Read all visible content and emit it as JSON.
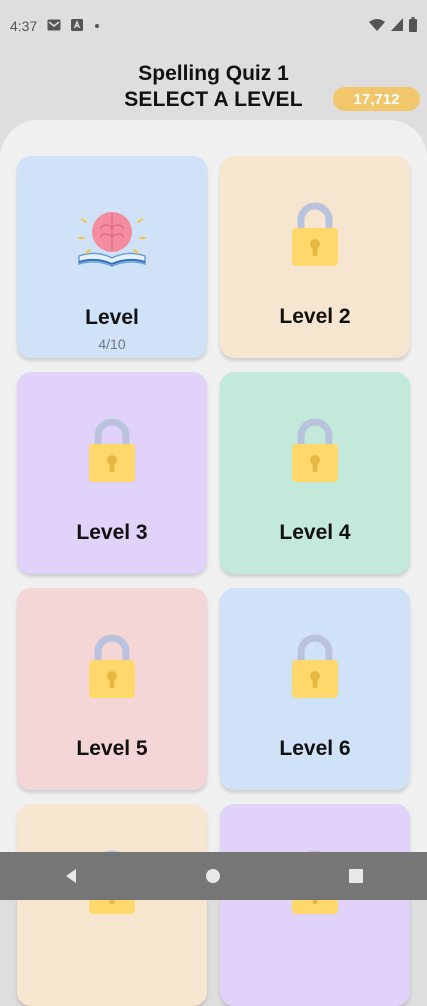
{
  "status_bar": {
    "time": "4:37",
    "icons": [
      "gmail-icon",
      "app-notification-icon",
      "dot-icon",
      "wifi-icon",
      "signal-icon",
      "battery-icon"
    ]
  },
  "header": {
    "title": "Spelling Quiz 1",
    "subtitle": "SELECT A LEVEL",
    "coins": "17,712",
    "coin_color": "#f2c66a"
  },
  "levels": [
    {
      "label": "Level",
      "progress": "4/10",
      "locked": false,
      "color": "#cfe2f7",
      "icon": "book-brain-icon"
    },
    {
      "label": "Level 2",
      "locked": true,
      "color": "#f6e6cf",
      "icon": "lock-icon"
    },
    {
      "label": "Level 3",
      "locked": true,
      "color": "#e0d2f8",
      "icon": "lock-icon"
    },
    {
      "label": "Level 4",
      "locked": true,
      "color": "#c2e9da",
      "icon": "lock-icon"
    },
    {
      "label": "Level 5",
      "locked": true,
      "color": "#f5d6d6",
      "icon": "lock-icon"
    },
    {
      "label": "Level 6",
      "locked": true,
      "color": "#cfe2f7",
      "icon": "lock-icon"
    },
    {
      "label": "",
      "locked": true,
      "color": "#f6e6cf",
      "icon": "lock-icon"
    },
    {
      "label": "",
      "locked": true,
      "color": "#e0d2f8",
      "icon": "lock-icon"
    }
  ],
  "nav": {
    "icons": [
      "back-icon",
      "home-icon",
      "recents-icon"
    ]
  }
}
